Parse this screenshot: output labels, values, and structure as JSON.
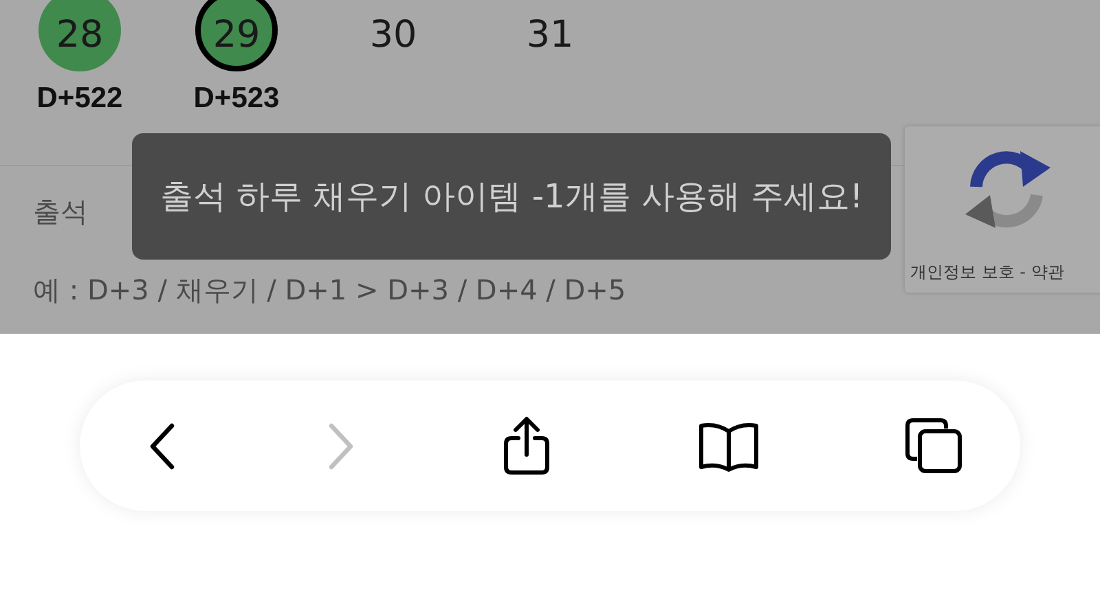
{
  "calendar": {
    "days": [
      {
        "day": "28",
        "attended": true,
        "selected": false,
        "label": "D+522"
      },
      {
        "day": "29",
        "attended": true,
        "selected": true,
        "label": "D+523"
      },
      {
        "day": "30",
        "attended": false,
        "selected": false
      },
      {
        "day": "31",
        "attended": false,
        "selected": false
      }
    ]
  },
  "note": {
    "lines": [
      "출석",
      "예 : D+3 / 채우기 / D+1 > D+3 / D+4 / D+5"
    ]
  },
  "toast": {
    "message": "출석 하루 채우기 아이템 -1개를 사용해 주세요!"
  },
  "recaptcha": {
    "links": "개인정보 보호 - 약관"
  },
  "toolbar": {
    "buttons": [
      {
        "kind": "back",
        "disabled": false
      },
      {
        "kind": "forward",
        "disabled": true
      },
      {
        "kind": "share",
        "disabled": false
      },
      {
        "kind": "bookmarks",
        "disabled": false
      },
      {
        "kind": "tabs",
        "disabled": false
      }
    ]
  }
}
